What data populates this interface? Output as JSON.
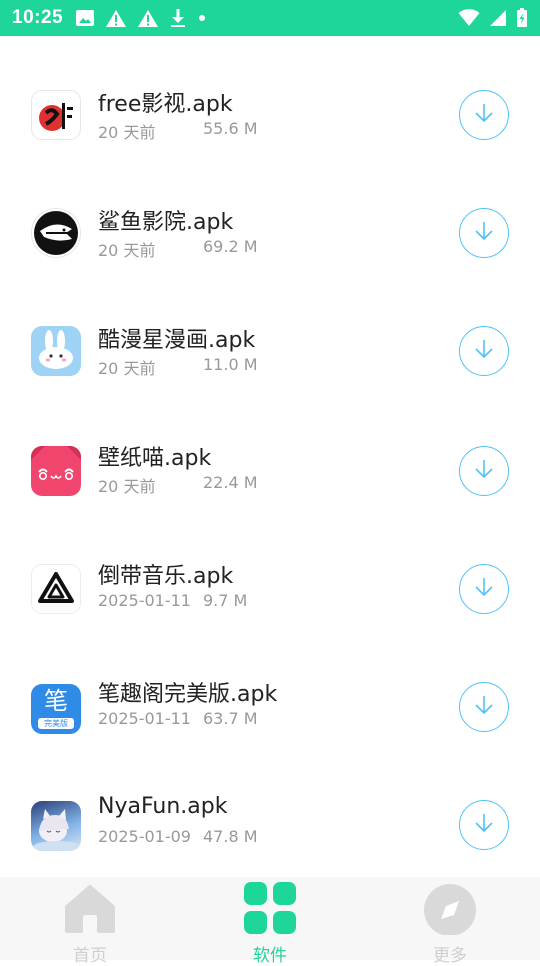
{
  "status_bar": {
    "time": "10:25",
    "left_icons": [
      "image-icon",
      "warning-icon",
      "warning-icon",
      "download-icon",
      "dot-icon"
    ],
    "right_icons": [
      "wifi-icon",
      "cell-signal-icon",
      "battery-charging-icon"
    ],
    "background": "#1fd69a"
  },
  "apps": [
    {
      "name": "free影视.apk",
      "date": "20 天前",
      "size": "55.6 M",
      "icon": "free-yingshi-app-icon"
    },
    {
      "name": "鲨鱼影院.apk",
      "date": "20 天前",
      "size": "69.2 M",
      "icon": "shark-cinema-app-icon"
    },
    {
      "name": "酷漫星漫画.apk",
      "date": "20 天前",
      "size": "11.0 M",
      "icon": "kuman-star-comic-app-icon"
    },
    {
      "name": "壁纸喵.apk",
      "date": "20 天前",
      "size": "22.4 M",
      "icon": "wallpaper-meow-app-icon"
    },
    {
      "name": "倒带音乐.apk",
      "date": "2025-01-11",
      "size": "9.7 M",
      "icon": "rewind-music-app-icon"
    },
    {
      "name": "笔趣阁完美版.apk",
      "date": "2025-01-11",
      "size": "63.7 M",
      "icon": "biquge-app-icon"
    },
    {
      "name": "NyaFun.apk",
      "date": "2025-01-09",
      "size": "47.8 M",
      "icon": "nyafun-app-icon"
    }
  ],
  "biquge_icon_text": {
    "char": "笔",
    "sub": "完美版"
  },
  "bottom_nav": {
    "items": [
      {
        "label": "首页",
        "icon": "home-icon",
        "active": false
      },
      {
        "label": "软件",
        "icon": "apps-grid-icon",
        "active": true
      },
      {
        "label": "更多",
        "icon": "compass-icon",
        "active": false
      }
    ],
    "active_color": "#1fd69a",
    "inactive_color": "#d9d9d9"
  },
  "accent_download_color": "#4fc3f7"
}
